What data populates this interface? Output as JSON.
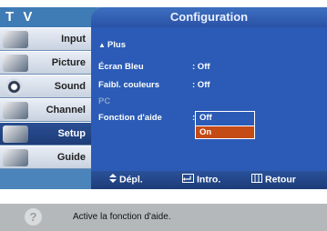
{
  "header": {
    "title": "T V",
    "tab": "Configuration"
  },
  "sidebar": {
    "items": [
      {
        "label": "Input",
        "icon": "input-icon"
      },
      {
        "label": "Picture",
        "icon": "picture-icon"
      },
      {
        "label": "Sound",
        "icon": "sound-icon"
      },
      {
        "label": "Channel",
        "icon": "channel-icon"
      },
      {
        "label": "Setup",
        "icon": "setup-icon"
      },
      {
        "label": "Guide",
        "icon": "guide-icon"
      }
    ]
  },
  "menu": {
    "plus": "Plus",
    "rows": [
      {
        "label": "Écran Bleu",
        "value": ": Off"
      },
      {
        "label": "Faibl. couleurs",
        "value": ": Off"
      },
      {
        "label": "PC",
        "value": ""
      },
      {
        "label": "Fonction d'aide",
        "value": ":"
      }
    ],
    "dropdown": {
      "options": [
        "Off",
        "On"
      ],
      "selected": "On"
    }
  },
  "footer": {
    "move": "Dépl.",
    "enter": "Intro.",
    "return": "Retour"
  },
  "help": {
    "text": "Active la fonction d'aide."
  },
  "colors": {
    "background": "#4a84bb",
    "panel": "#2b5bb6",
    "highlight": "#c44a16",
    "help_bar": "#b5b8bb"
  }
}
